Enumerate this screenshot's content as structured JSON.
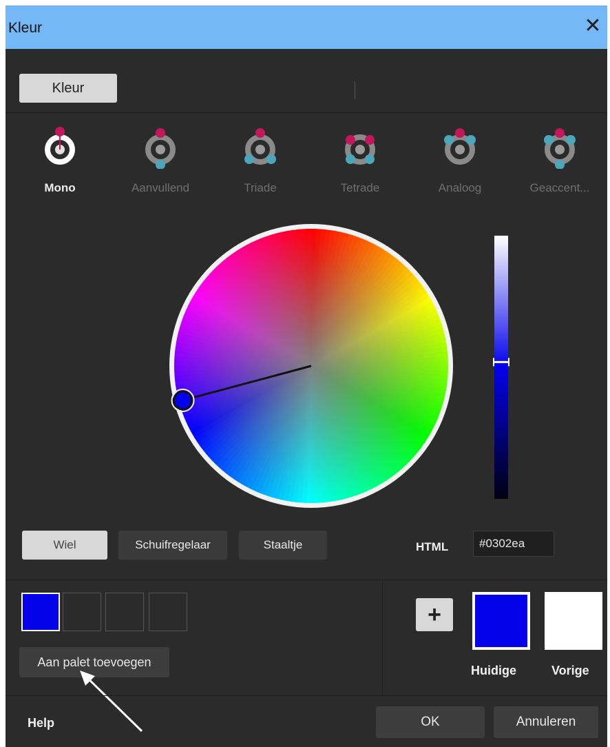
{
  "window": {
    "title": "Kleur",
    "close_icon": "close-icon"
  },
  "tabs": {
    "kleur_label": "Kleur"
  },
  "harmonies": [
    {
      "label": "Mono",
      "active": true
    },
    {
      "label": "Aanvullend",
      "active": false
    },
    {
      "label": "Triade",
      "active": false
    },
    {
      "label": "Tetrade",
      "active": false
    },
    {
      "label": "Analoog",
      "active": false
    },
    {
      "label": "Geaccent...",
      "active": false
    }
  ],
  "picker": {
    "hue_angle_deg": 255,
    "saturation": 0.97,
    "brightness_level": 0.52
  },
  "modes": {
    "wheel_label": "Wiel",
    "slider_label": "Schuifregelaar",
    "swatch_label": "Staaltje",
    "selected": "Wiel"
  },
  "html": {
    "label": "HTML",
    "value": "#0302ea"
  },
  "palette": {
    "add_label": "Aan palet toevoegen",
    "slots": [
      "#0302ea",
      "",
      "",
      ""
    ]
  },
  "compare": {
    "plus_label": "+",
    "current_label": "Huidige",
    "previous_label": "Vorige",
    "current_color": "#0302ea",
    "previous_color": "#ffffff"
  },
  "footer": {
    "help_label": "Help",
    "ok_label": "OK",
    "cancel_label": "Annuleren"
  },
  "colors": {
    "titlebar": "#75b8f7",
    "background": "#2b2b2b",
    "selected_color": "#0302ea",
    "accent_pink": "#c2185b",
    "accent_teal": "#4aa6b8"
  }
}
